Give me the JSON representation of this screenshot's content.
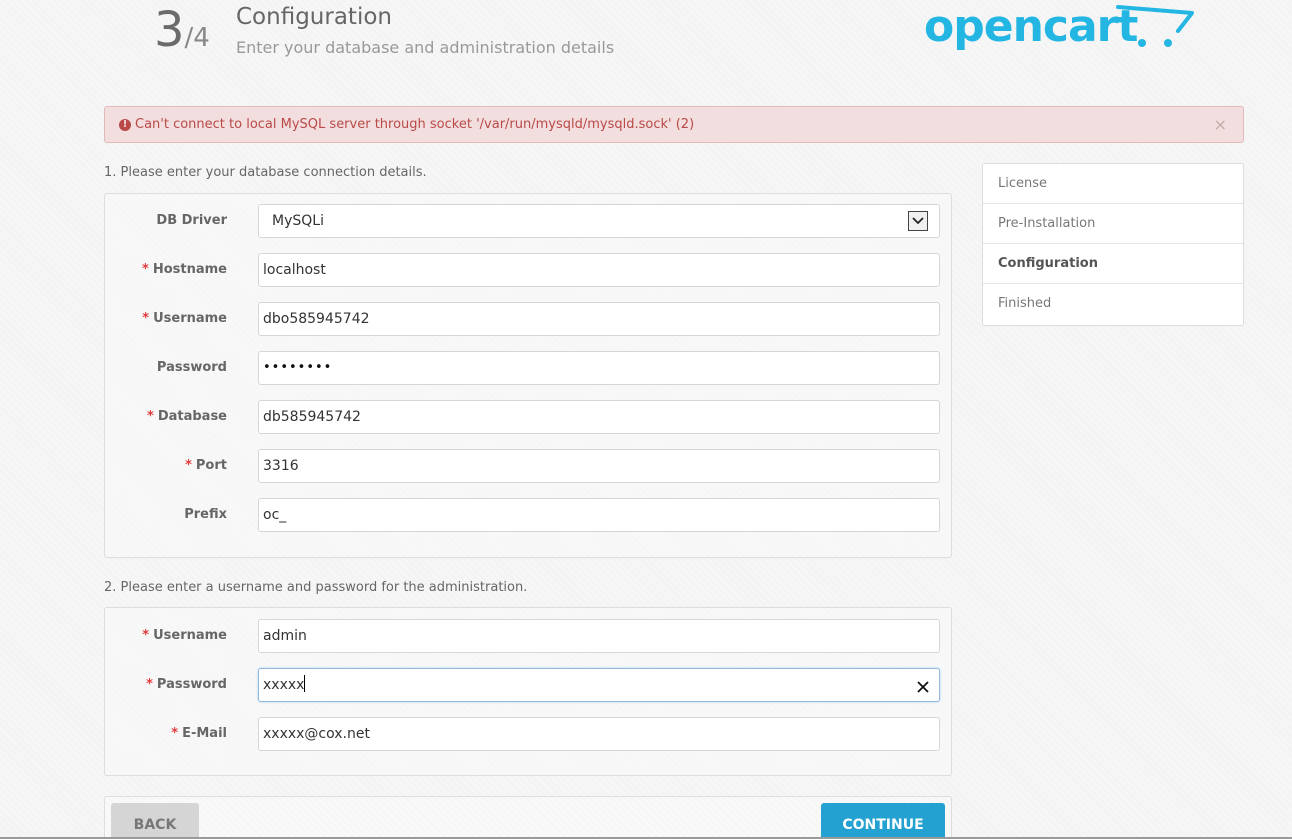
{
  "header": {
    "step_current": "3",
    "step_total": "/4",
    "title": "Configuration",
    "subtitle": "Enter your database and administration details",
    "logo_text": "opencart",
    "logo_color": "#24b6e3"
  },
  "alert": {
    "message": "Can't connect to local MySQL server through socket '/var/run/mysqld/mysqld.sock' (2)",
    "icon": "exclamation-circle-icon",
    "close": "×"
  },
  "database": {
    "legend": "1. Please enter your database connection details.",
    "driver": {
      "label": "DB Driver",
      "value": "MySQLi"
    },
    "hostname": {
      "label": "Hostname",
      "value": "localhost"
    },
    "username": {
      "label": "Username",
      "value": "dbo585945742"
    },
    "password": {
      "label": "Password",
      "value": "••••••••"
    },
    "database": {
      "label": "Database",
      "value": "db585945742"
    },
    "port": {
      "label": "Port",
      "value": "3316"
    },
    "prefix": {
      "label": "Prefix",
      "value": "oc_"
    }
  },
  "admin": {
    "legend": "2. Please enter a username and password for the administration.",
    "username": {
      "label": "Username",
      "value": "admin"
    },
    "password": {
      "label": "Password",
      "value": "xxxxx"
    },
    "email": {
      "label": "E-Mail",
      "value": "xxxxx@cox.net"
    }
  },
  "required_marker": "*",
  "sidenav": {
    "items": [
      "License",
      "Pre-Installation",
      "Configuration",
      "Finished"
    ],
    "active": "Configuration"
  },
  "buttons": {
    "back": "BACK",
    "continue": "CONTINUE"
  },
  "colors": {
    "accent": "#23a1d1",
    "alert_bg": "#f2dede",
    "alert_text": "#b94a48",
    "required": "#e03b3b"
  }
}
